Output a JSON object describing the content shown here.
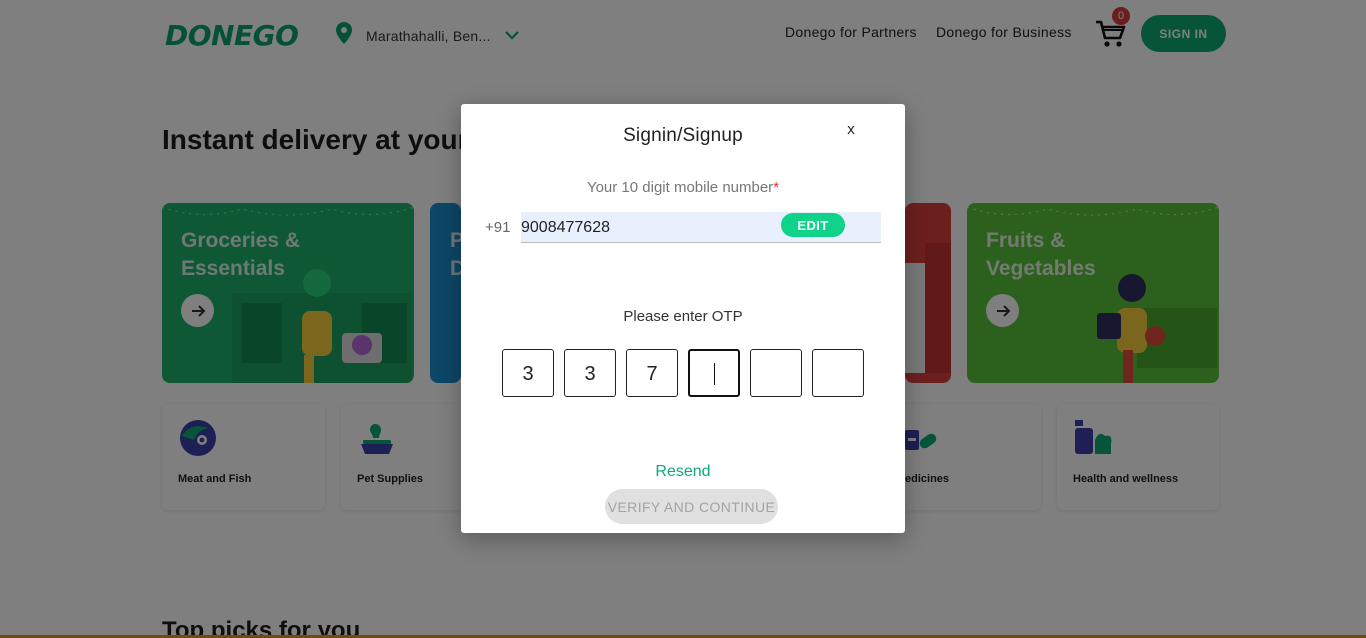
{
  "header": {
    "brand": "DONEGO",
    "location": "Marathahalli, Ben...",
    "links": [
      "Donego for Partners",
      "Donego for Business"
    ],
    "cart_count": "0",
    "signin_label": "SIGN IN"
  },
  "main": {
    "hero_title": "Instant delivery at your",
    "categories": [
      {
        "title": "Groceries & Essentials",
        "color": "#1fb16a"
      },
      {
        "title": "P D",
        "color": "#1b8fcf"
      },
      {
        "title": "",
        "color": "#d9403d"
      },
      {
        "title": "Fruits & Vegetables",
        "color": "#58c23a"
      }
    ],
    "tiles": [
      {
        "label": "Meat and Fish",
        "icon": "meat-icon"
      },
      {
        "label": "Pet Supplies",
        "icon": "pet-bowl-icon"
      },
      {
        "label": "edicines",
        "icon": "medicine-icon"
      },
      {
        "label": "Health and wellness",
        "icon": "wellness-icon"
      }
    ],
    "section_title": "Top picks for you"
  },
  "modal": {
    "title": "Signin/Signup",
    "close_label": "x",
    "mobile_label": "Your 10 digit mobile number",
    "required_mark": "*",
    "country_code": "+91",
    "phone": "9008477628",
    "edit_label": "EDIT",
    "otp_label": "Please enter OTP",
    "otp_digits": [
      "3",
      "3",
      "7",
      "",
      "",
      ""
    ],
    "resend_label": "Resend",
    "verify_label": "VERIFY AND CONTINUE"
  },
  "colors": {
    "brand_green": "#0cab72",
    "edit_green": "#10d38a",
    "required_red": "#e03333",
    "badge_red": "#d83a3a"
  }
}
